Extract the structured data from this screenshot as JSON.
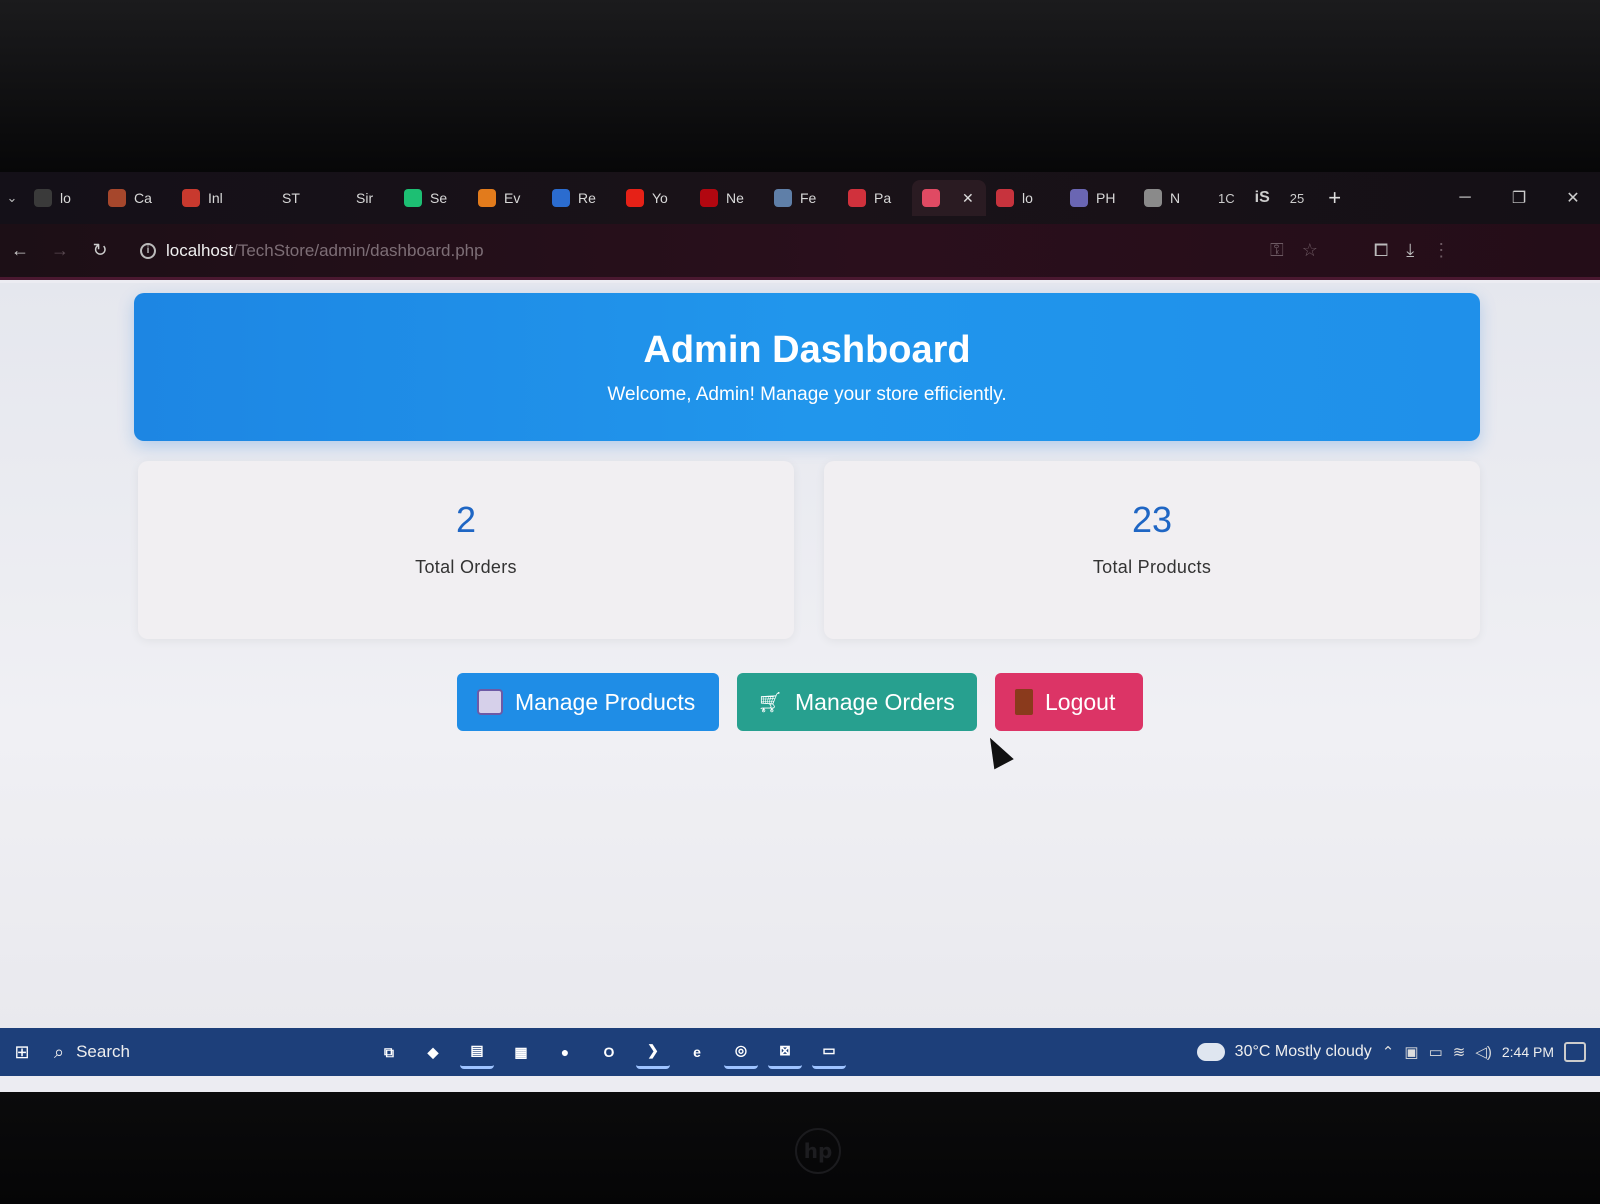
{
  "browser": {
    "tabs": [
      {
        "label": "lo",
        "icon": "page-icon",
        "color": "#3a3a3a"
      },
      {
        "label": "Ca",
        "icon": "calendar-icon",
        "color": "#a6472c"
      },
      {
        "label": "Inl",
        "icon": "gmail-icon",
        "color": "#c8392e"
      },
      {
        "label": "ST",
        "icon": "blank-icon",
        "color": "transparent"
      },
      {
        "label": "Sir",
        "icon": "blank-icon",
        "color": "transparent"
      },
      {
        "label": "Se",
        "icon": "fiverr-icon",
        "color": "#1dbf73"
      },
      {
        "label": "Ev",
        "icon": "evernote-icon",
        "color": "#e27b1c"
      },
      {
        "label": "Re",
        "icon": "arc-icon",
        "color": "#2b6ccf"
      },
      {
        "label": "Yo",
        "icon": "youtube-icon",
        "color": "#e62117"
      },
      {
        "label": "Ne",
        "icon": "netflix-icon",
        "color": "#b20710"
      },
      {
        "label": "Fe",
        "icon": "globe-icon",
        "color": "#5f7fa8"
      },
      {
        "label": "Pa",
        "icon": "dot-icon",
        "color": "#d0313c"
      },
      {
        "label": "",
        "icon": "xampp-icon",
        "color": "#e04a63",
        "active": true
      },
      {
        "label": "lo",
        "icon": "laravel-icon",
        "color": "#c7333d"
      },
      {
        "label": "PH",
        "icon": "php-icon",
        "color": "#6a66b3"
      },
      {
        "label": "N",
        "icon": "chrome-icon",
        "color": "#8a8a8a"
      }
    ],
    "extra_tabs": [
      "1C",
      "iS",
      "25"
    ],
    "url_host": "localhost",
    "url_path": "/TechStore/admin/dashboard.php"
  },
  "header": {
    "title": "Admin Dashboard",
    "subtitle": "Welcome, Admin! Manage your store efficiently."
  },
  "stats": [
    {
      "value": "2",
      "label": "Total Orders"
    },
    {
      "value": "23",
      "label": "Total Products"
    }
  ],
  "actions": {
    "products_label": "Manage Products",
    "orders_label": "Manage Orders",
    "logout_label": "Logout"
  },
  "taskbar": {
    "search_label": "Search",
    "weather": "30°C  Mostly cloudy",
    "time": "2:44 PM",
    "apps": [
      {
        "icon": "task-view-icon",
        "glyph": "⧉"
      },
      {
        "icon": "copilot-icon",
        "glyph": "◆"
      },
      {
        "icon": "file-explorer-icon",
        "glyph": "▤",
        "running": true
      },
      {
        "icon": "calculator-icon",
        "glyph": "▦"
      },
      {
        "icon": "steam-icon",
        "glyph": "●"
      },
      {
        "icon": "outlook-icon",
        "glyph": "O"
      },
      {
        "icon": "vscode-icon",
        "glyph": "❯",
        "running": true
      },
      {
        "icon": "edge-icon",
        "glyph": "e"
      },
      {
        "icon": "chrome-icon",
        "glyph": "◎",
        "running": true
      },
      {
        "icon": "xampp-icon",
        "glyph": "⊠",
        "running": true
      },
      {
        "icon": "keyboard-icon",
        "glyph": "▭",
        "running": true
      }
    ]
  }
}
